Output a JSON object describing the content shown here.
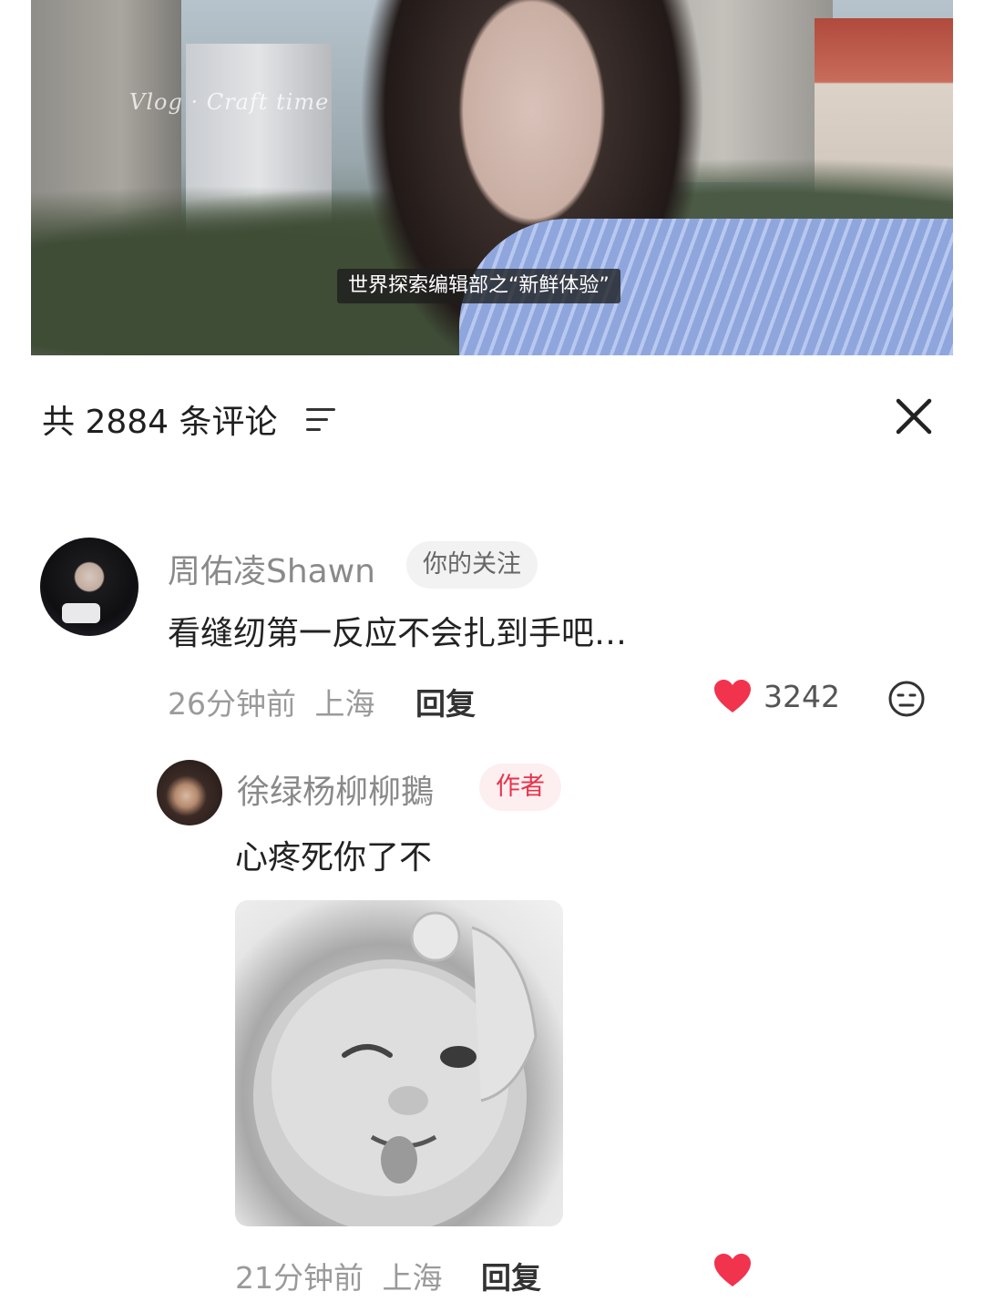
{
  "video": {
    "watermark": "Vlog · Craft time",
    "subtitle": "世界探索编辑部之“新鲜体验”"
  },
  "sheet": {
    "comment_count": "共 2884 条评论",
    "sort_icon": "sort-filter-icon",
    "close_icon": "close-icon"
  },
  "comments": [
    {
      "author": "周佑凌Shawn",
      "badge": "你的关注",
      "text": "看缝纫第一反应不会扎到手吧…",
      "time": "26分钟前",
      "location": "上海",
      "reply_label": "回复",
      "likes": "3242",
      "like_icon": "heart-icon",
      "dislike_icon": "meh-face-icon",
      "replies": [
        {
          "author": "徐绿杨柳柳鵝",
          "badge": "作者",
          "text": "心疼死你了不",
          "sticker": "winking-baby-sticker",
          "time": "21分钟前",
          "location": "上海",
          "reply_label": "回复",
          "like_icon": "heart-icon"
        }
      ]
    }
  ],
  "colors": {
    "like_red": "#f2334d",
    "author_badge_bg": "#fdeef0",
    "author_badge_text": "#e8334a",
    "follow_badge_bg": "#f2f2f2"
  }
}
